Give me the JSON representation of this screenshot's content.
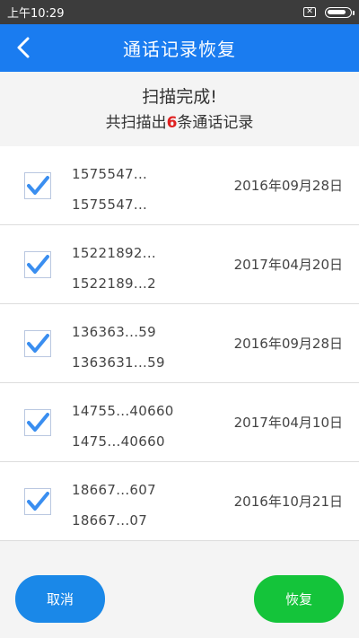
{
  "status_bar": {
    "time": "上午10:29",
    "sim_icon": "sim-x-icon",
    "battery_level": 0.85
  },
  "header": {
    "back_icon": "chevron-left-icon",
    "title": "通话记录恢复"
  },
  "summary": {
    "line1": "扫描完成!",
    "prefix": "共扫描出",
    "count": "6",
    "suffix": "条通话记录"
  },
  "records": [
    {
      "checked": true,
      "number1": "1575547...",
      "number2": "1575547...",
      "date": "2016年09月28日"
    },
    {
      "checked": true,
      "number1": "15221892...",
      "number2": "1522189...2",
      "date": "2017年04月20日"
    },
    {
      "checked": true,
      "number1": "136363...59",
      "number2": "1363631...59",
      "date": "2016年09月28日"
    },
    {
      "checked": true,
      "number1": "14755...40660",
      "number2": "1475...40660",
      "date": "2017年04月10日"
    },
    {
      "checked": true,
      "number1": "18667...607",
      "number2": "18667...07",
      "date": "2016年10月21日"
    }
  ],
  "buttons": {
    "cancel": "取消",
    "restore": "恢复"
  },
  "colors": {
    "header_bg": "#1a7cf0",
    "cancel_bg": "#1a88e8",
    "restore_bg": "#14c43a",
    "count_red": "#e02020",
    "check_blue": "#3a8ef0"
  }
}
